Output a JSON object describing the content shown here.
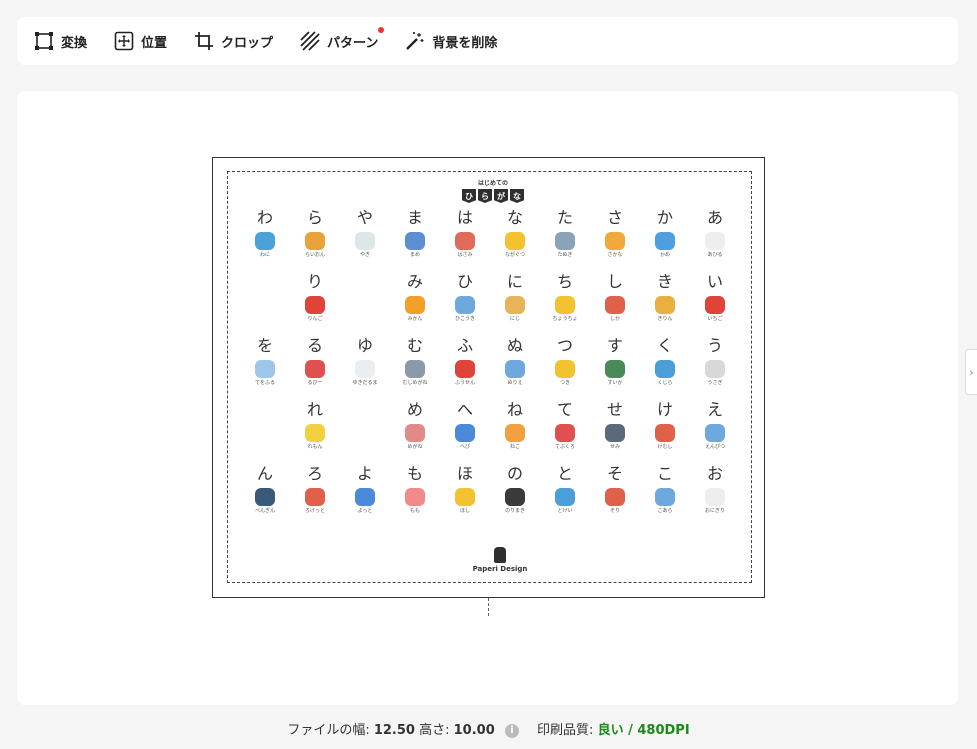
{
  "toolbar": {
    "items": [
      {
        "label": "変換",
        "icon": "transform-icon"
      },
      {
        "label": "位置",
        "icon": "position-icon"
      },
      {
        "label": "クロップ",
        "icon": "crop-icon"
      },
      {
        "label": "パターン",
        "icon": "pattern-icon",
        "badge_color": "#e33333"
      },
      {
        "label": "背景を削除",
        "icon": "magic-wand-icon"
      }
    ]
  },
  "poster": {
    "subtitle": "はじめての",
    "title_flags": [
      "ひ",
      "ら",
      "が",
      "な"
    ],
    "brand": "Paperi Design",
    "rows": [
      [
        {
          "kana": "わ",
          "word": "わに",
          "color": "#4aa3d8"
        },
        {
          "kana": "ら",
          "word": "らいおん",
          "color": "#e8a33a"
        },
        {
          "kana": "や",
          "word": "やぎ",
          "color": "#dfe6ea"
        },
        {
          "kana": "ま",
          "word": "まめ",
          "color": "#5b8fd1"
        },
        {
          "kana": "は",
          "word": "はさみ",
          "color": "#e06b5b"
        },
        {
          "kana": "な",
          "word": "ながぐつ",
          "color": "#f2c230"
        },
        {
          "kana": "た",
          "word": "たぬき",
          "color": "#8aa3b8"
        },
        {
          "kana": "さ",
          "word": "さかな",
          "color": "#f2a93b"
        },
        {
          "kana": "か",
          "word": "かめ",
          "color": "#4d9fe0"
        },
        {
          "kana": "あ",
          "word": "あひる",
          "color": "#eeeeee"
        }
      ],
      [
        {
          "kana": "",
          "word": "",
          "color": ""
        },
        {
          "kana": "り",
          "word": "りんご",
          "color": "#e0433a"
        },
        {
          "kana": "",
          "word": "",
          "color": ""
        },
        {
          "kana": "み",
          "word": "みかん",
          "color": "#f2a02a"
        },
        {
          "kana": "ひ",
          "word": "ひこうき",
          "color": "#6fa8dc"
        },
        {
          "kana": "に",
          "word": "にじ",
          "color": "#e8b45a"
        },
        {
          "kana": "ち",
          "word": "ちょうちょ",
          "color": "#f2c230"
        },
        {
          "kana": "し",
          "word": "しか",
          "color": "#e0604a"
        },
        {
          "kana": "き",
          "word": "きりん",
          "color": "#e8b040"
        },
        {
          "kana": "い",
          "word": "いちご",
          "color": "#e0433a"
        }
      ],
      [
        {
          "kana": "を",
          "word": "てをふる",
          "color": "#9cc7e8"
        },
        {
          "kana": "る",
          "word": "るびー",
          "color": "#e05050"
        },
        {
          "kana": "ゆ",
          "word": "ゆきだるま",
          "color": "#e8eef2"
        },
        {
          "kana": "む",
          "word": "むしめがね",
          "color": "#8a9aa8"
        },
        {
          "kana": "ふ",
          "word": "ふうせん",
          "color": "#e0433a"
        },
        {
          "kana": "ぬ",
          "word": "ぬりえ",
          "color": "#6fa8dc"
        },
        {
          "kana": "つ",
          "word": "つき",
          "color": "#f2c230"
        },
        {
          "kana": "す",
          "word": "すいか",
          "color": "#4a8a5a"
        },
        {
          "kana": "く",
          "word": "くじら",
          "color": "#4a9fd8"
        },
        {
          "kana": "う",
          "word": "うさぎ",
          "color": "#d8d8d8"
        }
      ],
      [
        {
          "kana": "",
          "word": "",
          "color": ""
        },
        {
          "kana": "れ",
          "word": "れもん",
          "color": "#f2d040"
        },
        {
          "kana": "",
          "word": "",
          "color": ""
        },
        {
          "kana": "め",
          "word": "めがね",
          "color": "#e08a8a"
        },
        {
          "kana": "へ",
          "word": "へび",
          "color": "#4a8ad8"
        },
        {
          "kana": "ね",
          "word": "ねこ",
          "color": "#f2a040"
        },
        {
          "kana": "て",
          "word": "てぶくろ",
          "color": "#e05050"
        },
        {
          "kana": "せ",
          "word": "せみ",
          "color": "#5a6a7a"
        },
        {
          "kana": "け",
          "word": "けむし",
          "color": "#e0604a"
        },
        {
          "kana": "え",
          "word": "えんぴつ",
          "color": "#6fa8dc"
        }
      ],
      [
        {
          "kana": "ん",
          "word": "ぺんぎん",
          "color": "#3a5a7a"
        },
        {
          "kana": "ろ",
          "word": "ろけっと",
          "color": "#e0604a"
        },
        {
          "kana": "よ",
          "word": "よっと",
          "color": "#4a8ad8"
        },
        {
          "kana": "も",
          "word": "もも",
          "color": "#f28a8a"
        },
        {
          "kana": "ほ",
          "word": "ほし",
          "color": "#f2c230"
        },
        {
          "kana": "の",
          "word": "のりまき",
          "color": "#3a3a3a"
        },
        {
          "kana": "と",
          "word": "とけい",
          "color": "#4a9fd8"
        },
        {
          "kana": "そ",
          "word": "そり",
          "color": "#e0604a"
        },
        {
          "kana": "こ",
          "word": "こあら",
          "color": "#6fa8dc"
        },
        {
          "kana": "お",
          "word": "おにぎり",
          "color": "#eeeeee"
        }
      ]
    ]
  },
  "footer": {
    "width_label": "ファイルの幅:",
    "width_value": "12.50",
    "height_label": "高さ:",
    "height_value": "10.00",
    "info_icon": "info-icon",
    "quality_label": "印刷品質:",
    "quality_value": "良い / 480DPI",
    "quality_color": "#1a8a1a"
  },
  "side_tab": {
    "icon": "chevron-right-icon",
    "glyph": "›"
  }
}
